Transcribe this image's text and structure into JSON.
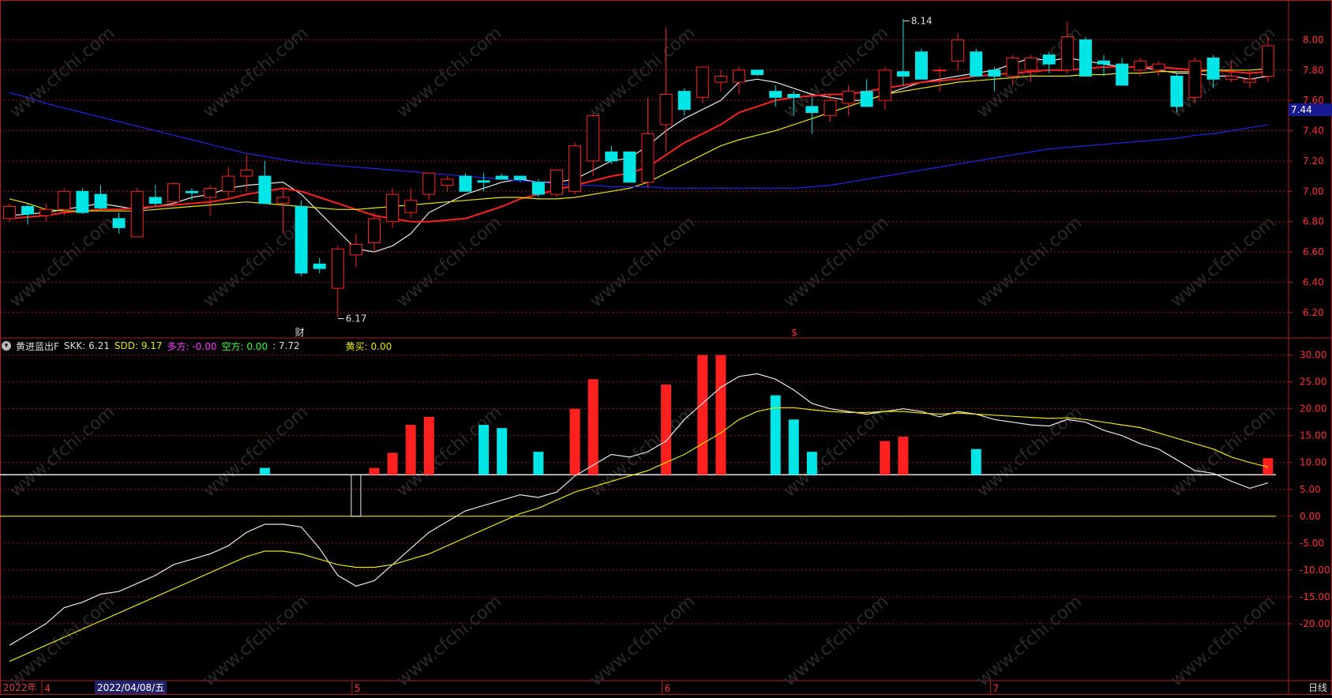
{
  "chart_data": [
    {
      "type": "candlestick",
      "title": "",
      "period_label": "日线",
      "ylim": [
        6.1,
        8.2
      ],
      "y_ticks": [
        "8.00",
        "7.80",
        "7.60",
        "7.40",
        "7.20",
        "7.00",
        "6.80",
        "6.60",
        "6.40",
        "6.20"
      ],
      "last_price_tag": "7.44",
      "annotations": {
        "high_label": "8.14",
        "low_label": "6.17",
        "event_label_1": "财",
        "event_label_2": "$"
      },
      "candles": [
        {
          "o": 6.82,
          "h": 6.92,
          "l": 6.8,
          "c": 6.9
        },
        {
          "o": 6.9,
          "h": 6.92,
          "l": 6.78,
          "c": 6.85
        },
        {
          "o": 6.84,
          "h": 6.92,
          "l": 6.8,
          "c": 6.88
        },
        {
          "o": 6.88,
          "h": 7.02,
          "l": 6.84,
          "c": 7.0
        },
        {
          "o": 7.0,
          "h": 7.02,
          "l": 6.85,
          "c": 6.86
        },
        {
          "o": 6.98,
          "h": 7.04,
          "l": 6.88,
          "c": 6.89
        },
        {
          "o": 6.82,
          "h": 6.86,
          "l": 6.72,
          "c": 6.76
        },
        {
          "o": 6.7,
          "h": 7.02,
          "l": 6.7,
          "c": 7.0
        },
        {
          "o": 6.96,
          "h": 7.04,
          "l": 6.9,
          "c": 6.92
        },
        {
          "o": 6.93,
          "h": 7.06,
          "l": 6.92,
          "c": 7.05
        },
        {
          "o": 7.0,
          "h": 7.02,
          "l": 6.94,
          "c": 6.99
        },
        {
          "o": 6.96,
          "h": 7.04,
          "l": 6.84,
          "c": 7.02
        },
        {
          "o": 7.0,
          "h": 7.16,
          "l": 6.96,
          "c": 7.1
        },
        {
          "o": 7.1,
          "h": 7.24,
          "l": 7.0,
          "c": 7.14
        },
        {
          "o": 7.1,
          "h": 7.2,
          "l": 6.92,
          "c": 6.92
        },
        {
          "o": 6.92,
          "h": 7.02,
          "l": 6.72,
          "c": 6.96
        },
        {
          "o": 6.9,
          "h": 6.94,
          "l": 6.44,
          "c": 6.46
        },
        {
          "o": 6.52,
          "h": 6.56,
          "l": 6.46,
          "c": 6.49
        },
        {
          "o": 6.36,
          "h": 6.64,
          "l": 6.17,
          "c": 6.62
        },
        {
          "o": 6.58,
          "h": 6.72,
          "l": 6.5,
          "c": 6.65
        },
        {
          "o": 6.66,
          "h": 6.86,
          "l": 6.6,
          "c": 6.82
        },
        {
          "o": 6.8,
          "h": 7.02,
          "l": 6.76,
          "c": 6.98
        },
        {
          "o": 6.86,
          "h": 7.02,
          "l": 6.82,
          "c": 6.94
        },
        {
          "o": 6.98,
          "h": 7.12,
          "l": 6.94,
          "c": 7.12
        },
        {
          "o": 7.04,
          "h": 7.1,
          "l": 7.0,
          "c": 7.08
        },
        {
          "o": 7.1,
          "h": 7.12,
          "l": 7.0,
          "c": 7.0
        },
        {
          "o": 7.07,
          "h": 7.12,
          "l": 7.0,
          "c": 7.06
        },
        {
          "o": 7.1,
          "h": 7.12,
          "l": 7.08,
          "c": 7.08
        },
        {
          "o": 7.1,
          "h": 7.1,
          "l": 7.06,
          "c": 7.08
        },
        {
          "o": 7.06,
          "h": 7.08,
          "l": 6.96,
          "c": 6.98
        },
        {
          "o": 6.98,
          "h": 7.14,
          "l": 6.96,
          "c": 7.14
        },
        {
          "o": 7.0,
          "h": 7.32,
          "l": 6.98,
          "c": 7.3
        },
        {
          "o": 7.2,
          "h": 7.52,
          "l": 7.1,
          "c": 7.5
        },
        {
          "o": 7.26,
          "h": 7.3,
          "l": 7.18,
          "c": 7.2
        },
        {
          "o": 7.26,
          "h": 7.26,
          "l": 7.06,
          "c": 7.06
        },
        {
          "o": 7.06,
          "h": 7.62,
          "l": 7.02,
          "c": 7.38
        },
        {
          "o": 7.44,
          "h": 8.08,
          "l": 7.26,
          "c": 7.64
        },
        {
          "o": 7.66,
          "h": 7.68,
          "l": 7.5,
          "c": 7.54
        },
        {
          "o": 7.62,
          "h": 7.82,
          "l": 7.58,
          "c": 7.82
        },
        {
          "o": 7.72,
          "h": 7.8,
          "l": 7.66,
          "c": 7.76
        },
        {
          "o": 7.72,
          "h": 7.82,
          "l": 7.64,
          "c": 7.8
        },
        {
          "o": 7.8,
          "h": 7.8,
          "l": 7.76,
          "c": 7.77
        },
        {
          "o": 7.66,
          "h": 7.7,
          "l": 7.56,
          "c": 7.62
        },
        {
          "o": 7.64,
          "h": 7.66,
          "l": 7.5,
          "c": 7.62
        },
        {
          "o": 7.56,
          "h": 7.62,
          "l": 7.38,
          "c": 7.52
        },
        {
          "o": 7.5,
          "h": 7.64,
          "l": 7.46,
          "c": 7.6
        },
        {
          "o": 7.58,
          "h": 7.7,
          "l": 7.5,
          "c": 7.66
        },
        {
          "o": 7.66,
          "h": 7.74,
          "l": 7.56,
          "c": 7.56
        },
        {
          "o": 7.6,
          "h": 7.82,
          "l": 7.54,
          "c": 7.8
        },
        {
          "o": 7.79,
          "h": 8.14,
          "l": 7.7,
          "c": 7.76
        },
        {
          "o": 7.92,
          "h": 7.94,
          "l": 7.74,
          "c": 7.74
        },
        {
          "o": 7.8,
          "h": 7.82,
          "l": 7.66,
          "c": 7.8
        },
        {
          "o": 7.86,
          "h": 8.04,
          "l": 7.8,
          "c": 8.0
        },
        {
          "o": 7.92,
          "h": 7.94,
          "l": 7.76,
          "c": 7.76
        },
        {
          "o": 7.8,
          "h": 7.82,
          "l": 7.66,
          "c": 7.76
        },
        {
          "o": 7.76,
          "h": 7.9,
          "l": 7.7,
          "c": 7.88
        },
        {
          "o": 7.8,
          "h": 7.9,
          "l": 7.72,
          "c": 7.88
        },
        {
          "o": 7.9,
          "h": 7.92,
          "l": 7.78,
          "c": 7.84
        },
        {
          "o": 7.8,
          "h": 8.12,
          "l": 7.78,
          "c": 8.02
        },
        {
          "o": 8.0,
          "h": 8.02,
          "l": 7.76,
          "c": 7.76
        },
        {
          "o": 7.86,
          "h": 7.9,
          "l": 7.76,
          "c": 7.84
        },
        {
          "o": 7.84,
          "h": 7.88,
          "l": 7.7,
          "c": 7.7
        },
        {
          "o": 7.8,
          "h": 7.88,
          "l": 7.76,
          "c": 7.86
        },
        {
          "o": 7.8,
          "h": 7.86,
          "l": 7.76,
          "c": 7.84
        },
        {
          "o": 7.76,
          "h": 7.78,
          "l": 7.52,
          "c": 7.56
        },
        {
          "o": 7.62,
          "h": 7.88,
          "l": 7.58,
          "c": 7.86
        },
        {
          "o": 7.88,
          "h": 7.9,
          "l": 7.68,
          "c": 7.74
        },
        {
          "o": 7.74,
          "h": 7.86,
          "l": 7.72,
          "c": 7.76
        },
        {
          "o": 7.72,
          "h": 7.8,
          "l": 7.68,
          "c": 7.74
        },
        {
          "o": 7.76,
          "h": 8.02,
          "l": 7.72,
          "c": 7.96
        }
      ],
      "series": [
        {
          "name": "MA5",
          "color": "#e8e8e8",
          "values": [
            6.84,
            6.85,
            6.86,
            6.88,
            6.9,
            6.92,
            6.9,
            6.88,
            6.9,
            6.92,
            6.96,
            6.98,
            7.02,
            7.04,
            7.05,
            7.06,
            6.98,
            6.86,
            6.74,
            6.62,
            6.6,
            6.64,
            6.72,
            6.86,
            6.92,
            6.98,
            7.02,
            7.06,
            7.08,
            7.06,
            7.06,
            7.08,
            7.14,
            7.2,
            7.22,
            7.3,
            7.4,
            7.48,
            7.54,
            7.6,
            7.72,
            7.74,
            7.72,
            7.68,
            7.64,
            7.62,
            7.6,
            7.6,
            7.64,
            7.68,
            7.72,
            7.74,
            7.76,
            7.78,
            7.8,
            7.84,
            7.88,
            7.86,
            7.88,
            7.86,
            7.84,
            7.82,
            7.82,
            7.8,
            7.78,
            7.78,
            7.76,
            7.76,
            7.74,
            7.76
          ]
        },
        {
          "name": "MA10",
          "color": "#ff2020",
          "values": [
            6.82,
            6.83,
            6.84,
            6.86,
            6.87,
            6.88,
            6.88,
            6.89,
            6.9,
            6.91,
            6.92,
            6.93,
            6.95,
            6.98,
            7.0,
            7.02,
            7.0,
            6.96,
            6.92,
            6.88,
            6.84,
            6.82,
            6.8,
            6.8,
            6.81,
            6.82,
            6.86,
            6.9,
            6.95,
            6.98,
            7.01,
            7.04,
            7.07,
            7.1,
            7.12,
            7.16,
            7.24,
            7.32,
            7.38,
            7.44,
            7.52,
            7.56,
            7.6,
            7.62,
            7.63,
            7.64,
            7.64,
            7.66,
            7.68,
            7.7,
            7.72,
            7.73,
            7.74,
            7.76,
            7.77,
            7.78,
            7.79,
            7.8,
            7.8,
            7.81,
            7.82,
            7.82,
            7.82,
            7.82,
            7.81,
            7.8,
            7.8,
            7.79,
            7.78,
            7.79
          ]
        },
        {
          "name": "MA20",
          "color": "#e6e600",
          "values": [
            6.95,
            6.92,
            6.88,
            6.87,
            6.87,
            6.87,
            6.87,
            6.87,
            6.88,
            6.89,
            6.9,
            6.91,
            6.92,
            6.93,
            6.92,
            6.91,
            6.9,
            6.89,
            6.88,
            6.88,
            6.89,
            6.9,
            6.91,
            6.92,
            6.93,
            6.94,
            6.95,
            6.96,
            6.96,
            6.95,
            6.95,
            6.96,
            6.98,
            7.0,
            7.02,
            7.06,
            7.12,
            7.18,
            7.24,
            7.3,
            7.34,
            7.37,
            7.4,
            7.44,
            7.48,
            7.52,
            7.56,
            7.6,
            7.64,
            7.66,
            7.68,
            7.7,
            7.72,
            7.73,
            7.74,
            7.75,
            7.76,
            7.76,
            7.76,
            7.77,
            7.77,
            7.78,
            7.78,
            7.79,
            7.79,
            7.79,
            7.8,
            7.8,
            7.8,
            7.81
          ]
        },
        {
          "name": "MA60",
          "color": "#2222ee",
          "values": [
            7.65,
            7.62,
            7.58,
            7.55,
            7.52,
            7.49,
            7.46,
            7.43,
            7.4,
            7.37,
            7.34,
            7.31,
            7.28,
            7.25,
            7.23,
            7.21,
            7.19,
            7.18,
            7.17,
            7.16,
            7.15,
            7.14,
            7.13,
            7.12,
            7.11,
            7.1,
            7.09,
            7.08,
            7.07,
            7.06,
            7.05,
            7.04,
            7.04,
            7.03,
            7.03,
            7.03,
            7.02,
            7.02,
            7.02,
            7.02,
            7.02,
            7.02,
            7.02,
            7.02,
            7.03,
            7.04,
            7.06,
            7.08,
            7.1,
            7.12,
            7.14,
            7.16,
            7.18,
            7.2,
            7.22,
            7.24,
            7.26,
            7.28,
            7.29,
            7.3,
            7.31,
            7.32,
            7.33,
            7.34,
            7.35,
            7.37,
            7.38,
            7.4,
            7.42,
            7.44
          ]
        }
      ]
    },
    {
      "type": "bar",
      "title": "",
      "indicator_name": "黄进蓝出F",
      "ylim": [
        -30,
        32
      ],
      "baseline": 7.72,
      "y_ticks": [
        "30.00",
        "25.00",
        "20.00",
        "15.00",
        "10.00",
        "5.00",
        "0.00",
        "-5.00",
        "-10.00",
        "-15.00",
        "-20.00"
      ],
      "legend": {
        "skk_label": "SKK:",
        "skk_value": "6.21",
        "sdd_label": "SDD:",
        "sdd_value": "9.17",
        "duo_label": "多方:",
        "duo_value": "-0.00",
        "kong_label": "空方:",
        "kong_value": "0.00",
        "base_value": ": 7.72",
        "buy_label": "黄买:",
        "buy_value": "0.00"
      },
      "bars": [
        {
          "i": 14,
          "v": 9.0,
          "color": "cyan"
        },
        {
          "i": 19,
          "v": 0.0,
          "color": "hollow"
        },
        {
          "i": 20,
          "v": 9.0,
          "color": "red"
        },
        {
          "i": 21,
          "v": 11.8,
          "color": "red"
        },
        {
          "i": 22,
          "v": 17.0,
          "color": "red"
        },
        {
          "i": 23,
          "v": 18.5,
          "color": "red"
        },
        {
          "i": 26,
          "v": 17.0,
          "color": "cyan"
        },
        {
          "i": 27,
          "v": 16.4,
          "color": "cyan"
        },
        {
          "i": 29,
          "v": 12.0,
          "color": "cyan"
        },
        {
          "i": 31,
          "v": 20.0,
          "color": "red"
        },
        {
          "i": 32,
          "v": 25.5,
          "color": "red"
        },
        {
          "i": 36,
          "v": 24.5,
          "color": "red"
        },
        {
          "i": 38,
          "v": 30.0,
          "color": "red"
        },
        {
          "i": 39,
          "v": 30.0,
          "color": "red"
        },
        {
          "i": 42,
          "v": 22.5,
          "color": "cyan"
        },
        {
          "i": 43,
          "v": 18.0,
          "color": "cyan"
        },
        {
          "i": 44,
          "v": 12.0,
          "color": "cyan"
        },
        {
          "i": 48,
          "v": 14.0,
          "color": "red"
        },
        {
          "i": 49,
          "v": 14.8,
          "color": "red"
        },
        {
          "i": 53,
          "v": 12.5,
          "color": "cyan"
        },
        {
          "i": 69,
          "v": 10.8,
          "color": "red"
        }
      ],
      "series": [
        {
          "name": "SKK",
          "color": "#e8e8e8",
          "values": [
            -24,
            -22,
            -20,
            -17,
            -16,
            -14.5,
            -14,
            -12.5,
            -11,
            -9,
            -8,
            -7,
            -5.5,
            -3,
            -1.5,
            -1.5,
            -2,
            -6,
            -11,
            -13,
            -12,
            -9,
            -6,
            -3,
            -1,
            1,
            2,
            3,
            4,
            3.5,
            4.5,
            7.5,
            9.5,
            11.5,
            11,
            12,
            14,
            18,
            21,
            24,
            26,
            26.5,
            25.5,
            23.5,
            21,
            20,
            19.5,
            19,
            19.5,
            20,
            19.5,
            18.5,
            19.5,
            19,
            18,
            17.5,
            17,
            16.8,
            18,
            17.5,
            16,
            15,
            13.5,
            12.5,
            10.5,
            8.5,
            8,
            6.5,
            5.2,
            6.2
          ]
        },
        {
          "name": "SDD",
          "color": "#e6e600",
          "values": [
            -27,
            -25.5,
            -24,
            -22.5,
            -21,
            -19.5,
            -18,
            -16.5,
            -15,
            -13.5,
            -12,
            -10.5,
            -9,
            -7.5,
            -6.5,
            -6.5,
            -7,
            -8,
            -9,
            -9.5,
            -9.5,
            -9,
            -8,
            -7,
            -5.5,
            -4,
            -2.5,
            -1,
            0.5,
            1.5,
            3,
            4.5,
            5.5,
            6.5,
            7.5,
            8.5,
            10,
            11.5,
            13.5,
            15.5,
            18,
            19.5,
            20.2,
            20.2,
            19.8,
            19.5,
            19.3,
            19.3,
            19.5,
            19.5,
            19.2,
            19,
            19.2,
            19,
            18.8,
            18.6,
            18.4,
            18.2,
            18.3,
            18,
            17.5,
            17,
            16.5,
            15.5,
            14.5,
            13.5,
            12.5,
            11,
            10,
            9.17
          ]
        }
      ]
    }
  ],
  "axis_labels": {
    "year": "2022年",
    "date_box": "2022/04/08/五",
    "month_4": "4",
    "month_5": "5",
    "month_6": "6",
    "month_7": "7"
  },
  "watermark": "www.cfchi.com",
  "colors": {
    "up": "#ff2020",
    "down": "#00e5e5",
    "grid": "#8b1a1a",
    "frame": "#b01c1c",
    "axis_text": "#ff3030"
  }
}
